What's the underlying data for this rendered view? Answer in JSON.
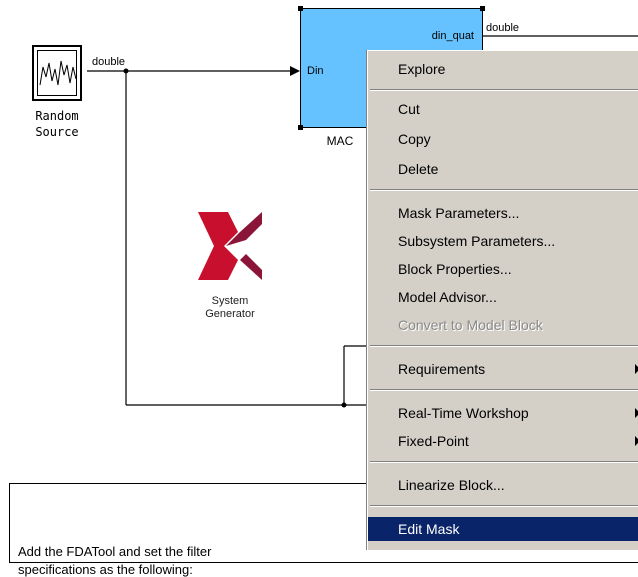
{
  "canvas": {
    "random_source": {
      "label_line1": "Random",
      "label_line2": "Source",
      "output_signal": "double"
    },
    "mac_block": {
      "label": "MAC",
      "input_port": "Din",
      "output_port": "din_quat",
      "output_signal": "double"
    },
    "system_generator": {
      "label_line1": "System",
      "label_line2": "Generator",
      "logo_colors": [
        "#c8102e",
        "#8a1538"
      ]
    },
    "annotation": {
      "line1": "Add the FDATool and set the filter",
      "line2": "specifications as the following:"
    },
    "colors": {
      "mac_fill": "#66c2ff",
      "menu_bg": "#d4d0c8",
      "menu_selected": "#0a246a"
    }
  },
  "context_menu": {
    "groups": [
      [
        {
          "label": "Explore",
          "enabled": true
        }
      ],
      [
        {
          "label": "Cut",
          "enabled": true
        },
        {
          "label": "Copy",
          "enabled": true
        },
        {
          "label": "Delete",
          "enabled": true
        }
      ],
      [
        {
          "label": "Mask Parameters...",
          "enabled": true
        },
        {
          "label": "Subsystem Parameters...",
          "enabled": true
        },
        {
          "label": "Block Properties...",
          "enabled": true
        },
        {
          "label": "Model Advisor...",
          "enabled": true
        },
        {
          "label": "Convert to Model Block",
          "enabled": false
        }
      ],
      [
        {
          "label": "Requirements",
          "enabled": true,
          "submenu": true
        }
      ],
      [
        {
          "label": "Real-Time Workshop",
          "enabled": true,
          "submenu": true
        },
        {
          "label": "Fixed-Point",
          "enabled": true,
          "submenu": true
        }
      ],
      [
        {
          "label": "Linearize Block...",
          "enabled": true
        }
      ],
      [
        {
          "label": "Edit Mask",
          "enabled": true,
          "selected": true
        }
      ]
    ]
  }
}
